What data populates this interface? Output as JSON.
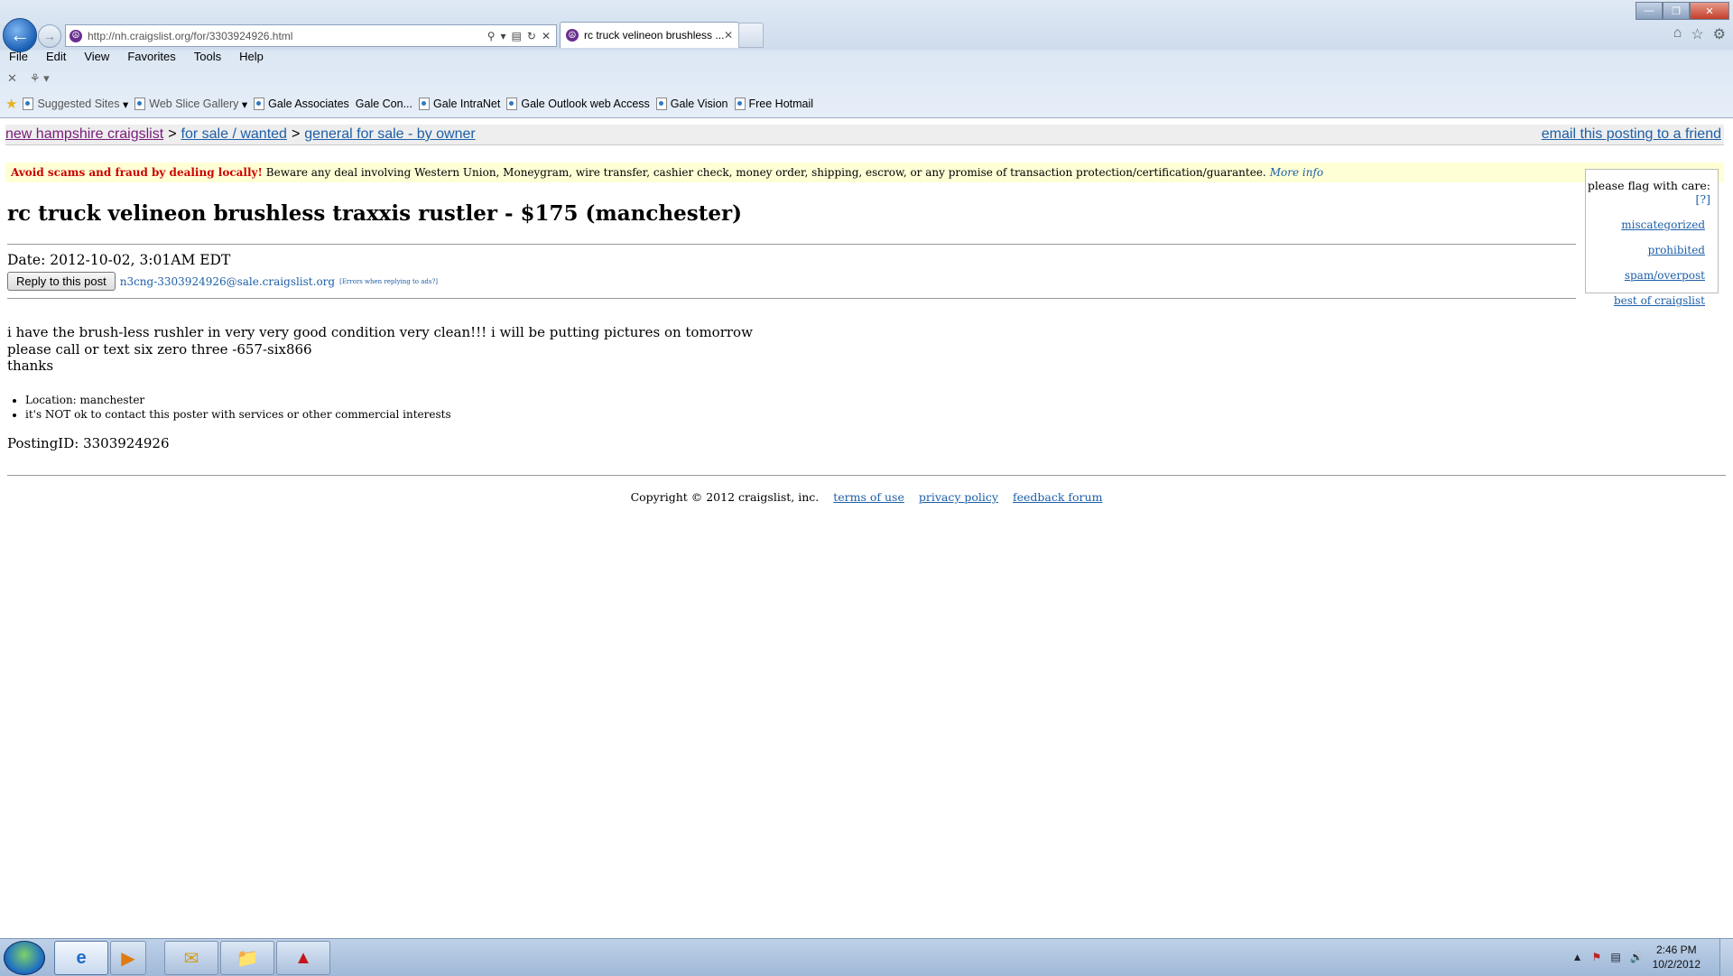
{
  "browser": {
    "url": "http://nh.craigslist.org/for/3303924926.html",
    "tab_title": "rc truck velineon brushless ...",
    "menu": [
      "File",
      "Edit",
      "View",
      "Favorites",
      "Tools",
      "Help"
    ],
    "favorites": [
      {
        "label": "Suggested Sites",
        "dropdown": true
      },
      {
        "label": "Web Slice Gallery",
        "dropdown": true
      },
      {
        "label": "Gale Associates",
        "dropdown": false
      },
      {
        "label": "Gale Con...",
        "dropdown": false
      },
      {
        "label": "Gale IntraNet",
        "dropdown": false
      },
      {
        "label": "Gale Outlook web Access",
        "dropdown": false
      },
      {
        "label": "Gale Vision",
        "dropdown": false
      },
      {
        "label": "Free Hotmail",
        "dropdown": false
      }
    ]
  },
  "page": {
    "breadcrumb": {
      "site": "new hampshire craigslist",
      "sep1": ">",
      "section": "for sale / wanted",
      "sep2": ">",
      "category": "general for sale - by owner"
    },
    "email_friend": "email this posting to a friend",
    "warning": {
      "bold": "Avoid scams and fraud by dealing locally!",
      "text": "Beware any deal involving Western Union, Moneygram, wire transfer, cashier check, money order, shipping, escrow, or any promise of transaction protection/certification/guarantee.",
      "more": "More info"
    },
    "flag": {
      "header": "please flag with care:",
      "help": "[?]",
      "items": [
        "miscategorized",
        "prohibited",
        "spam/overpost",
        "best of craigslist"
      ]
    },
    "title": "rc truck velineon brushless traxxis rustler - $175 (manchester)",
    "date": "Date: 2012-10-02, 3:01AM EDT",
    "reply_button": "Reply to this post",
    "reply_email": "n3cng-3303924926@sale.craigslist.org",
    "reply_errors": "[Errors when replying to ads?]",
    "body": "i have the brush-less rushler in very very good condition very clean!!! i will be putting pictures on tomorrow\nplease call or text six zero three -657-six866\nthanks",
    "info": [
      "Location: manchester",
      "it's NOT ok to contact this poster with services or other commercial interests"
    ],
    "posting_id": "PostingID: 3303924926",
    "footer": {
      "copyright": "Copyright © 2012 craigslist, inc.",
      "terms": "terms of use",
      "privacy": "privacy policy",
      "feedback": "feedback forum"
    }
  },
  "taskbar": {
    "time": "2:46 PM",
    "date": "10/2/2012"
  }
}
